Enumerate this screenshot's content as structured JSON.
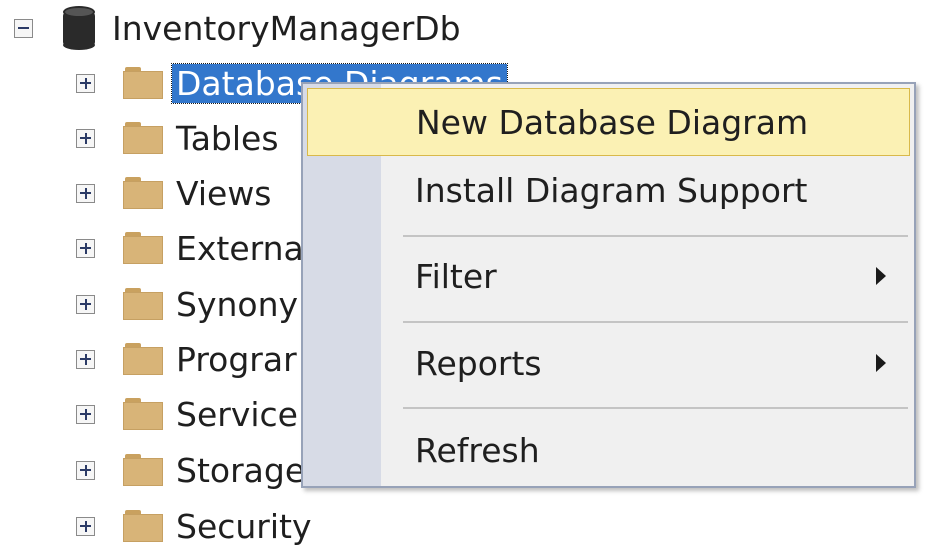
{
  "tree": {
    "root": {
      "label": "InventoryManagerDb",
      "expander": "collapse",
      "icon": "database-icon"
    },
    "children": [
      {
        "label": "Database Diagrams",
        "selected": true
      },
      {
        "label": "Tables"
      },
      {
        "label": "Views"
      },
      {
        "label": "Externa"
      },
      {
        "label": "Synony"
      },
      {
        "label": "Prograr"
      },
      {
        "label": "Service"
      },
      {
        "label": "Storage"
      },
      {
        "label": "Security"
      }
    ]
  },
  "context_menu": {
    "items": [
      {
        "label": "New Database Diagram",
        "highlighted": true,
        "submenu": false
      },
      {
        "label": "Install Diagram Support",
        "submenu": false
      },
      {
        "label": "Filter",
        "submenu": true
      },
      {
        "label": "Reports",
        "submenu": true
      },
      {
        "label": "Refresh",
        "submenu": false
      }
    ]
  },
  "colors": {
    "selection": "#3377cc",
    "menu_highlight": "#fbf1b4",
    "menu_gutter": "#d7dbe6",
    "folder": "#d8b478"
  }
}
